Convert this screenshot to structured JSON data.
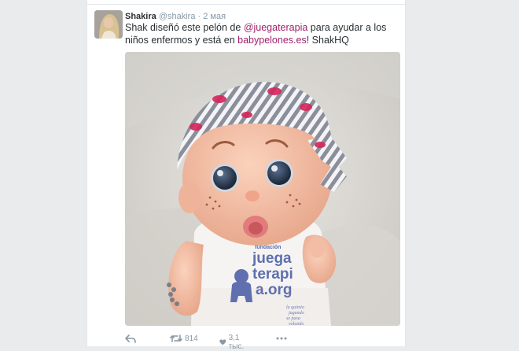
{
  "tweet": {
    "author_name": "Shakira",
    "author_handle": "@shakira",
    "separator": "·",
    "date": "2 мая",
    "text_prefix": "Shak diseñó este pelón de ",
    "mention": "@juegaterapia",
    "text_middle": " para ayudar a los niños enfermos y está en ",
    "link": "babypelones.es",
    "text_suffix": "! ShakHQ",
    "media": {
      "shirt_logo_lines": [
        "fundación",
        "juega",
        "terapi",
        "a.org"
      ],
      "shirt_tagline_lines": [
        "la quimio",
        "jugando",
        "se pasa",
        "volando"
      ]
    },
    "actions": {
      "retweet_count": "814",
      "like_count": "3,1 тыс."
    }
  },
  "colors": {
    "link": "#a0206b",
    "secondary_text": "#8899a6",
    "logo_blue": "#5f6fb0"
  }
}
